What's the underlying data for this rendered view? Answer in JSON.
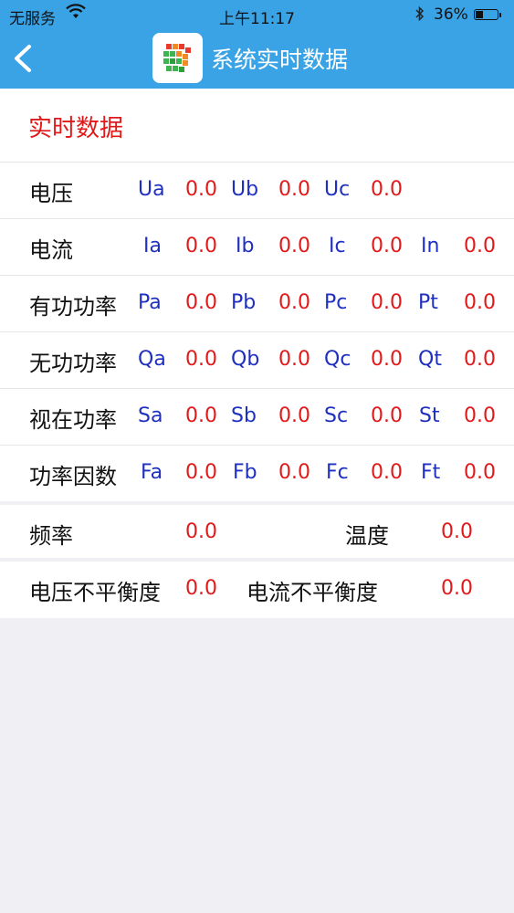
{
  "status_bar": {
    "carrier": "无服务",
    "time": "上午11:17",
    "battery": "36%"
  },
  "nav": {
    "title": "系统实时数据"
  },
  "section_title": "实时数据",
  "rows": [
    {
      "label": "电压",
      "cells": [
        {
          "key": "Ua",
          "value": "0.0"
        },
        {
          "key": "Ub",
          "value": "0.0"
        },
        {
          "key": "Uc",
          "value": "0.0"
        }
      ]
    },
    {
      "label": "电流",
      "cells": [
        {
          "key": "Ia",
          "value": "0.0"
        },
        {
          "key": "Ib",
          "value": "0.0"
        },
        {
          "key": "Ic",
          "value": "0.0"
        },
        {
          "key": "In",
          "value": "0.0"
        }
      ]
    },
    {
      "label": "有功功率",
      "cells": [
        {
          "key": "Pa",
          "value": "0.0"
        },
        {
          "key": "Pb",
          "value": "0.0"
        },
        {
          "key": "Pc",
          "value": "0.0"
        },
        {
          "key": "Pt",
          "value": "0.0"
        }
      ]
    },
    {
      "label": "无功功率",
      "cells": [
        {
          "key": "Qa",
          "value": "0.0"
        },
        {
          "key": "Qb",
          "value": "0.0"
        },
        {
          "key": "Qc",
          "value": "0.0"
        },
        {
          "key": "Qt",
          "value": "0.0"
        }
      ]
    },
    {
      "label": "视在功率",
      "cells": [
        {
          "key": "Sa",
          "value": "0.0"
        },
        {
          "key": "Sb",
          "value": "0.0"
        },
        {
          "key": "Sc",
          "value": "0.0"
        },
        {
          "key": "St",
          "value": "0.0"
        }
      ]
    },
    {
      "label": "功率因数",
      "cells": [
        {
          "key": "Fa",
          "value": "0.0"
        },
        {
          "key": "Fb",
          "value": "0.0"
        },
        {
          "key": "Fc",
          "value": "0.0"
        },
        {
          "key": "Ft",
          "value": "0.0"
        }
      ]
    }
  ],
  "freq_row": {
    "freq_label": "频率",
    "freq_value": "0.0",
    "temp_label": "温度",
    "temp_value": "0.0"
  },
  "imbalance_row": {
    "voltage_label": "电压不平衡度",
    "voltage_value": "0.0",
    "current_label": "电流不平衡度",
    "current_value": "0.0"
  },
  "colors": {
    "header": "#3aa3e6",
    "key_text": "#1f2fc0",
    "value_text": "#e01a1a"
  }
}
